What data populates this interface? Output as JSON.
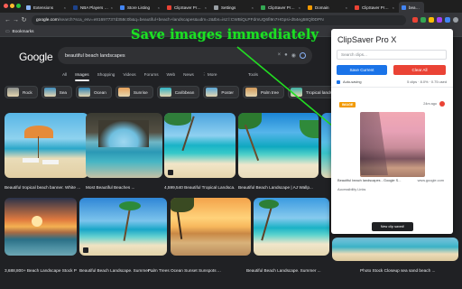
{
  "browser": {
    "tabs": [
      {
        "label": "Extensions",
        "color": "#8ab4f8"
      },
      {
        "label": "NBA Players & Teams",
        "color": "#1d428a"
      },
      {
        "label": "Store Listing",
        "color": "#4285f4"
      },
      {
        "label": "ClipSaver Pro X - C",
        "color": "#ea4335"
      },
      {
        "label": "Settings",
        "color": "#9aa0a6"
      },
      {
        "label": "ClipSaver Pro X - E",
        "color": "#34a853"
      },
      {
        "label": "Domain",
        "color": "#f29900"
      },
      {
        "label": "ClipSaver Pro X - Ir",
        "color": "#ea4335"
      },
      {
        "label": "beautifu",
        "color": "#4285f4"
      }
    ],
    "url_domain": "google.com",
    "url_rest": "/search?sca_esv=e81697737d358c0b&q=beautiful+beach+landscapes&udm=2&tbs=isz:l:CWBiQLPFdmUQ6fi9n7HGpsi-d54eg58Ql0DPN",
    "bookmarks_label": "Bookmarks"
  },
  "google": {
    "logo": "Google",
    "query": "beautiful beach landscapes",
    "tabs": [
      "All",
      "Images",
      "Shopping",
      "Videos",
      "Forums",
      "Web",
      "News",
      "⋮ More"
    ],
    "active_tab": "Images",
    "tools": "Tools",
    "chips": [
      "Rock",
      "Sea",
      "Ocean",
      "Sunrise",
      "Caribbean",
      "Poster",
      "Palm tree",
      "Tropical landscape"
    ],
    "row1_captions": [
      "Beautiful tropical beach banner. White ...",
      "Most Beautiful Beaches ...",
      "4,599,540 Beautiful Tropical Landsca...",
      "Beautiful Beach Landscape | AJ Wallp..."
    ],
    "row2_captions": [
      "3,688,800+ Beach Landscape Stock Ph...",
      "Beautiful Beach Landscape. Summer ...",
      "Palm Trees Ocean Sunset Sunspots ...",
      "Beautiful Beach Landscape. Summer ...",
      "Photo Stock Closeup sea sand beach ..."
    ]
  },
  "overlay": {
    "headline": "Save images immediately",
    "headline_color": "#1ee022"
  },
  "extension": {
    "title": "ClipSaver Pro X",
    "search_placeholder": "Search clips...",
    "save_label": "Save Current",
    "clear_label": "Clear All",
    "autosave_label": "Auto-saving",
    "stats": "5 clips · 8.0% · 0.75 used",
    "clip": {
      "tag": "IMAGE",
      "time": "24m ago",
      "title": "Beautiful beach landscapes - Google S...",
      "source": "www.google.com",
      "alt": "Accessibility Links"
    },
    "toast": "New clip saved!"
  }
}
